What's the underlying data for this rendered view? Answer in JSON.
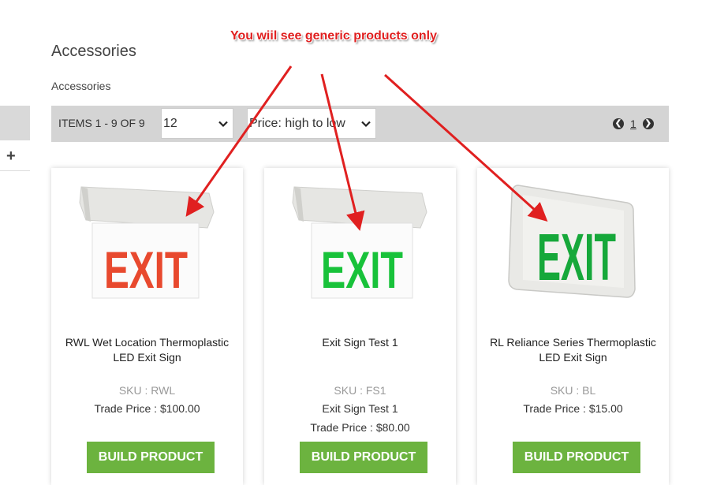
{
  "page": {
    "title": "Accessories",
    "breadcrumb": "Accessories"
  },
  "sidebar": {
    "expand_label": "+"
  },
  "toolbar": {
    "items_count": "ITEMS 1 - 9 OF 9",
    "per_page": "12",
    "sort": "Price: high to low",
    "current_page": "1",
    "prev_icon": "chevron-left-circle-icon",
    "next_icon": "chevron-right-circle-icon"
  },
  "annotation": {
    "text": "You wiil see generic products only",
    "color": "#e02020"
  },
  "products": [
    {
      "name": "RWL Wet Location Thermoplastic LED Exit Sign",
      "sku": "SKU : RWL",
      "price": "Trade Price : $100.00",
      "button": "BUILD PRODUCT",
      "sign_text": "EXIT",
      "sign_color": "#e8492e"
    },
    {
      "name": "Exit Sign Test 1",
      "sku": "SKU : FS1",
      "subtitle": "Exit Sign Test 1",
      "price": "Trade Price : $80.00",
      "button": "BUILD PRODUCT",
      "sign_text": "EXIT",
      "sign_color": "#18c23a"
    },
    {
      "name": "RL Reliance Series Thermoplastic LED Exit Sign",
      "sku": "SKU : BL",
      "price": "Trade Price : $15.00",
      "button": "BUILD PRODUCT",
      "sign_text": "EXIT",
      "sign_color": "#16a83a"
    }
  ],
  "colors": {
    "button_green": "#6cb33f",
    "toolbar_gray": "#d4d4d4",
    "arrow_red": "#e02020"
  }
}
